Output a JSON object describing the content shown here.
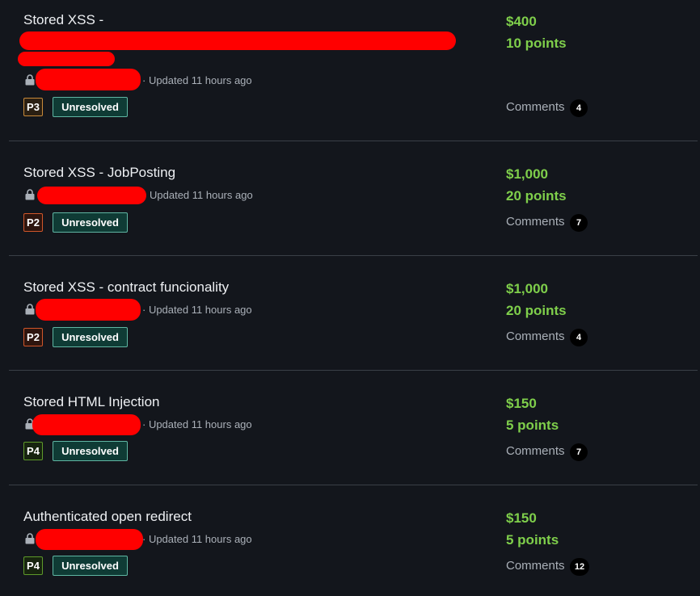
{
  "reports": [
    {
      "title": "Stored XSS -",
      "updated": "· Updated 11 hours ago",
      "priority": "P3",
      "status": "Unresolved",
      "bounty": "$400",
      "points": "10 points",
      "comments_label": "Comments",
      "comments_count": "4"
    },
    {
      "title": "Stored XSS - JobPosting",
      "updated": "Updated 11 hours ago",
      "priority": "P2",
      "status": "Unresolved",
      "bounty": "$1,000",
      "points": "20 points",
      "comments_label": "Comments",
      "comments_count": "7"
    },
    {
      "title": "Stored XSS - contract funcionality",
      "updated": "· Updated 11 hours ago",
      "priority": "P2",
      "status": "Unresolved",
      "bounty": "$1,000",
      "points": "20 points",
      "comments_label": "Comments",
      "comments_count": "4"
    },
    {
      "title": "Stored HTML Injection",
      "updated": "· Updated 11 hours ago",
      "priority": "P4",
      "status": "Unresolved",
      "bounty": "$150",
      "points": "5 points",
      "comments_label": "Comments",
      "comments_count": "7"
    },
    {
      "title": "Authenticated open redirect",
      "updated": "· Updated 11 hours ago",
      "priority": "P4",
      "status": "Unresolved",
      "bounty": "$150",
      "points": "5 points",
      "comments_label": "Comments",
      "comments_count": "12"
    }
  ],
  "colors": {
    "background": "#13161c",
    "bounty_green": "#7fcf4b",
    "redaction": "#ff0000",
    "status_bg": "#0f3b35",
    "status_border": "#5fb6a3",
    "P3_border": "#c88a3a",
    "P3_bg": "#2a1f12",
    "P2_border": "#d0562a",
    "P2_bg": "#2e150e",
    "P4_border": "#5e9a2a",
    "P4_bg": "#17240f"
  },
  "icons": {
    "lock": "lock-icon"
  }
}
